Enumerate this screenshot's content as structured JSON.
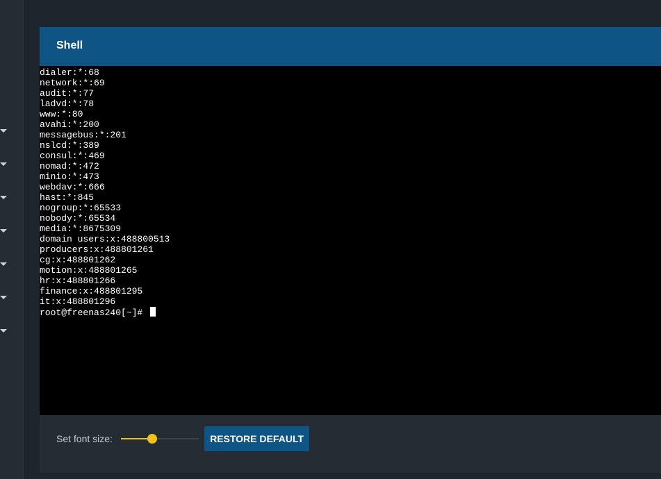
{
  "sidebar": {
    "expand_carets": [
      "chevron-down-icon",
      "chevron-down-icon",
      "chevron-down-icon",
      "chevron-down-icon",
      "chevron-down-icon",
      "chevron-down-icon",
      "chevron-down-icon"
    ]
  },
  "card": {
    "title": "Shell"
  },
  "terminal": {
    "lines": [
      "dialer:*:68",
      "network:*:69",
      "audit:*:77",
      "ladvd:*:78",
      "www:*:80",
      "avahi:*:200",
      "messagebus:*:201",
      "nslcd:*:389",
      "consul:*:469",
      "nomad:*:472",
      "minio:*:473",
      "webdav:*:666",
      "hast:*:845",
      "nogroup:*:65533",
      "nobody:*:65534",
      "media:*:8675309",
      "domain users:x:488800513",
      "producers:x:488801261",
      "cg:x:488801262",
      "motion:x:488801265",
      "hr:x:488801266",
      "finance:x:488801295",
      "it:x:488801296"
    ],
    "prompt": "root@freenas240[~]# "
  },
  "footer": {
    "font_size_label": "Set font size:",
    "font_size_fraction": 0.4,
    "restore_label": "RESTORE DEFAULT"
  },
  "colors": {
    "header": "#0e5485",
    "accent": "#f0c419",
    "terminal_bg": "#000000"
  }
}
